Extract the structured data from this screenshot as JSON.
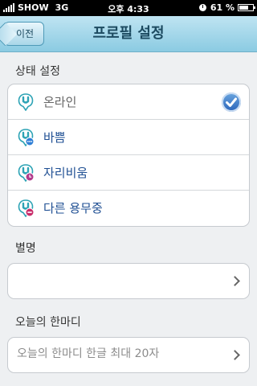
{
  "status_bar": {
    "carrier": "SHOW",
    "network": "3G",
    "time": "오후 4:33",
    "battery": "61 %"
  },
  "nav": {
    "back_label": "이전",
    "title": "프로필 설정"
  },
  "status_section": {
    "label": "상태 설정",
    "items": [
      {
        "label": "온라인",
        "color": "#666666",
        "badge": "none",
        "selected": true
      },
      {
        "label": "바쁨",
        "color": "#1f4f93",
        "badge": "busy",
        "selected": false
      },
      {
        "label": "자리비움",
        "color": "#1f4f93",
        "badge": "away",
        "selected": false
      },
      {
        "label": "다른 용무중",
        "color": "#1f4f93",
        "badge": "other",
        "selected": false
      }
    ]
  },
  "nickname_section": {
    "label": "별명",
    "value": ""
  },
  "message_section": {
    "label": "오늘의 한마디",
    "placeholder": "오늘의 한마디 한글 최대 20자"
  },
  "colors": {
    "accent": "#2a64b9",
    "icon_teal": "#2da3b5",
    "busy": "#2f7fd6",
    "away": "#b23a8c",
    "other": "#c82c6a"
  }
}
